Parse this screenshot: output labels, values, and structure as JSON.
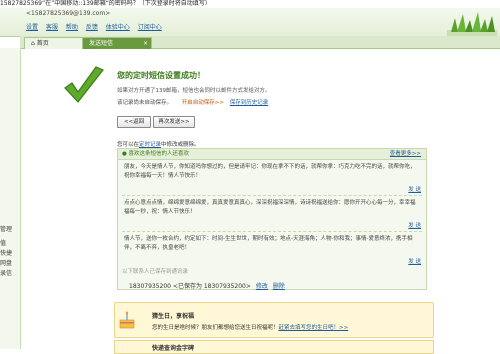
{
  "window_title": "15827825369“在”中国移动::139邮箱“的密码吗？（下次登录时将自动填写）",
  "header": {
    "account": "<15827825369@139.com>",
    "menu": [
      "设置",
      "客服",
      "帮助",
      "反馈",
      "体验中心",
      "订阅中心"
    ]
  },
  "tabs": {
    "home": "首页",
    "sms": "发送短信",
    "close": "×"
  },
  "sidebar": {
    "labels": [
      "管理",
      "值",
      "快捷",
      "网盘",
      "录信"
    ]
  },
  "success": {
    "title": "您的定时短信设置成功！",
    "desc": "如果对方开通了139邮箱，短信也会同时以邮件方式发给对方。",
    "record_label": "该记录尚未自动保存。",
    "auto_save": "开启自动保存>>",
    "save_link": "保存到历史记录"
  },
  "buttons": {
    "back": "<<返回",
    "again": "再次发送>>"
  },
  "timer_note": {
    "prefix": "您可以在",
    "link": "定时记录",
    "suffix": "中修改或删除。"
  },
  "greeting": {
    "title": "● 喜欢这条短信的人还喜欢",
    "more": "查看更多>>",
    "messages": [
      "朋友，今天是情人节，你知道吗你想过的，但是请牢记：你现在拿不下的话，就帮你拿：巧克力吃不完的话，就帮你吃，祝你幸福每一天！情人节快乐！",
      "点点心意点点情，绵绵爱意绵绵爱，真真爱意真真心，深深祝福深深情，诗诗祝福送给你：愿你开开心心每一分，幸幸福福每一秒，祝：情人节快乐！",
      "情人节，送你一枚合约，约定如下：时间-生生世世，期时有效；地点-天涯海角；人物-你和我；事情-爱意终浓，携手相伴，不离不弃，执皇老吧！"
    ],
    "send_label": "发 送"
  },
  "contacts": {
    "note": "以下联系人已保存到通讯录",
    "number": "18307935200",
    "saved": "<已保存为 18307935200>",
    "edit": "修改",
    "delete": "删除"
  },
  "birthday": {
    "title": "猜生日，享祝福",
    "text_prefix": "您的生日是啥时候？朋友们都想给您送生日祝福呢！",
    "link": "赶紧去填写您的生日吧！>>"
  },
  "bottom": {
    "title": "快递查询金字碑"
  },
  "colors": {
    "accent_green": "#3d7a1a",
    "tab_active": "#6a9a3e",
    "link_blue": "#1f5c99",
    "orange": "#c25400"
  }
}
